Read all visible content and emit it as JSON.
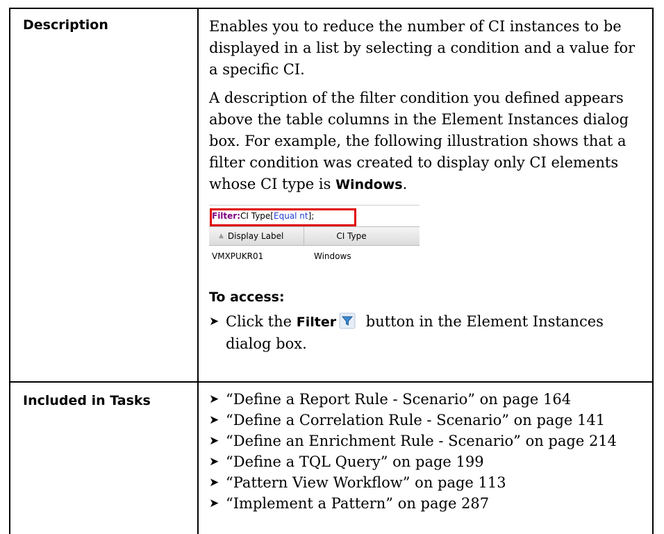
{
  "rows": {
    "description": {
      "label": "Description",
      "para1": "Enables you to reduce the number of CI instances to be displayed in a list by selecting a condition and a value for a specific CI.",
      "para2_prefix": "A description of the filter condition you defined appears above the table columns in the Element Instances dialog box. For example, the following illustration shows that a filter condition was created to display only CI elements whose CI type is ",
      "para2_bold": "Windows",
      "para2_suffix": ".",
      "illustration": {
        "filter_label": "Filter:",
        "filter_text": " CI Type[",
        "filter_value": "Equal nt",
        "filter_end": "];",
        "columns": [
          "Display Label",
          "CI Type"
        ],
        "row": [
          "VMXPUKR01",
          "Windows"
        ]
      },
      "to_access": "To access:",
      "access_prefix": "Click the ",
      "access_bold": "Filter",
      "access_suffix": " button in the Element Instances dialog box."
    },
    "tasks": {
      "label": "Included in Tasks",
      "items": [
        "“Define a Report Rule - Scenario” on page 164",
        "“Define a Correlation Rule - Scenario” on page 141",
        "“Define an Enrichment Rule - Scenario” on page 214",
        "“Define a TQL Query” on page 199",
        "“Pattern View Workflow” on page 113",
        "“Implement a Pattern” on page 287"
      ]
    }
  },
  "icons": {
    "bullet": "arrowhead-bullet",
    "filter": "funnel-filter-icon"
  },
  "colors": {
    "filter_highlight": "#e00000",
    "filter_label": "#800080",
    "filter_value": "#1f3fd0"
  }
}
